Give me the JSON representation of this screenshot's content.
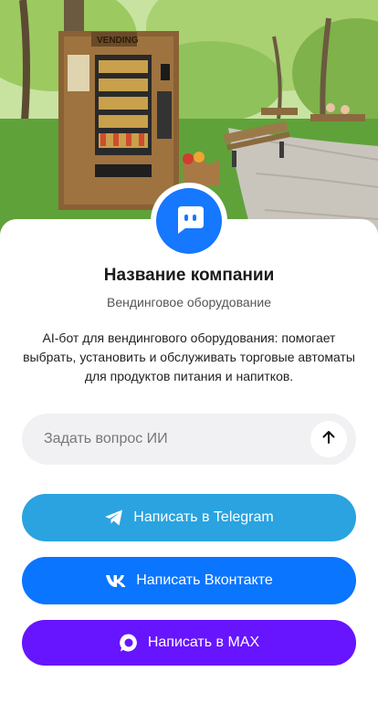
{
  "hero": {
    "image_alt": "vending-machine-in-park",
    "sign_text": "VENDING"
  },
  "avatar": {
    "icon": "chat-bot-icon",
    "color": "#1677ff"
  },
  "company": {
    "name": "Название компании",
    "subtitle": "Вендинговое оборудование",
    "description": "AI-бот для вендингового оборудования: помогает выбрать, установить и обслуживать торговые автоматы для продуктов питания и напитков."
  },
  "ask": {
    "placeholder": "Задать вопрос ИИ",
    "value": "",
    "send_icon": "arrow-up-icon"
  },
  "buttons": {
    "telegram": {
      "label": "Написать в Telegram",
      "icon": "telegram-icon",
      "color": "#2aa3e0"
    },
    "vk": {
      "label": "Написать Вконтакте",
      "icon": "vk-icon",
      "color": "#0a75ff"
    },
    "max": {
      "label": "Написать в MAX",
      "icon": "max-icon",
      "color": "#6714ff"
    }
  }
}
